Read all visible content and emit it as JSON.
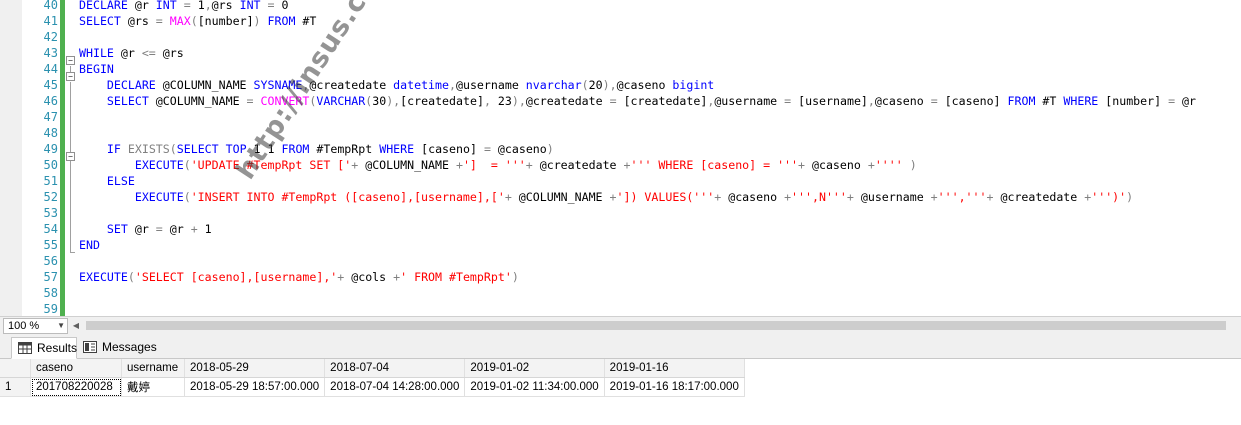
{
  "editor": {
    "line_numbers": [
      "40",
      "41",
      "42",
      "43",
      "44",
      "45",
      "46",
      "47",
      "48",
      "49",
      "50",
      "51",
      "52",
      "53",
      "54",
      "55",
      "56",
      "57",
      "58",
      "59"
    ],
    "lines": [
      [
        {
          "t": "kw",
          "v": "DECLARE"
        },
        {
          "t": "plain",
          "v": " @r "
        },
        {
          "t": "kw",
          "v": "INT"
        },
        {
          "t": "plain",
          "v": " "
        },
        {
          "t": "op",
          "v": "="
        },
        {
          "t": "plain",
          "v": " 1"
        },
        {
          "t": "op",
          "v": ","
        },
        {
          "t": "plain",
          "v": "@rs "
        },
        {
          "t": "kw",
          "v": "INT"
        },
        {
          "t": "plain",
          "v": " "
        },
        {
          "t": "op",
          "v": "="
        },
        {
          "t": "plain",
          "v": " 0"
        }
      ],
      [
        {
          "t": "kw",
          "v": "SELECT"
        },
        {
          "t": "plain",
          "v": " @rs "
        },
        {
          "t": "op",
          "v": "="
        },
        {
          "t": "plain",
          "v": " "
        },
        {
          "t": "fn",
          "v": "MAX"
        },
        {
          "t": "op",
          "v": "("
        },
        {
          "t": "plain",
          "v": "[number]"
        },
        {
          "t": "op",
          "v": ")"
        },
        {
          "t": "plain",
          "v": " "
        },
        {
          "t": "kw",
          "v": "FROM"
        },
        {
          "t": "plain",
          "v": " #T"
        }
      ],
      [],
      [
        {
          "t": "kw",
          "v": "WHILE"
        },
        {
          "t": "plain",
          "v": " @r "
        },
        {
          "t": "op",
          "v": "<="
        },
        {
          "t": "plain",
          "v": " @rs"
        }
      ],
      [
        {
          "t": "kw",
          "v": "BEGIN"
        }
      ],
      [
        {
          "t": "plain",
          "v": "    "
        },
        {
          "t": "kw",
          "v": "DECLARE"
        },
        {
          "t": "plain",
          "v": " @COLUMN_NAME "
        },
        {
          "t": "kw",
          "v": "SYSNAME"
        },
        {
          "t": "op",
          "v": ","
        },
        {
          "t": "plain",
          "v": "@createdate "
        },
        {
          "t": "kw",
          "v": "datetime"
        },
        {
          "t": "op",
          "v": ","
        },
        {
          "t": "plain",
          "v": "@username "
        },
        {
          "t": "kw",
          "v": "nvarchar"
        },
        {
          "t": "op",
          "v": "("
        },
        {
          "t": "plain",
          "v": "20"
        },
        {
          "t": "op",
          "v": "),"
        },
        {
          "t": "plain",
          "v": "@caseno "
        },
        {
          "t": "kw",
          "v": "bigint"
        }
      ],
      [
        {
          "t": "plain",
          "v": "    "
        },
        {
          "t": "kw",
          "v": "SELECT"
        },
        {
          "t": "plain",
          "v": " @COLUMN_NAME "
        },
        {
          "t": "op",
          "v": "="
        },
        {
          "t": "plain",
          "v": " "
        },
        {
          "t": "fn",
          "v": "CONVERT"
        },
        {
          "t": "op",
          "v": "("
        },
        {
          "t": "kw",
          "v": "VARCHAR"
        },
        {
          "t": "op",
          "v": "("
        },
        {
          "t": "plain",
          "v": "30"
        },
        {
          "t": "op",
          "v": "),"
        },
        {
          "t": "plain",
          "v": "[createdate]"
        },
        {
          "t": "op",
          "v": ","
        },
        {
          "t": "plain",
          "v": " 23"
        },
        {
          "t": "op",
          "v": "),"
        },
        {
          "t": "plain",
          "v": "@createdate "
        },
        {
          "t": "op",
          "v": "="
        },
        {
          "t": "plain",
          "v": " [createdate]"
        },
        {
          "t": "op",
          "v": ","
        },
        {
          "t": "plain",
          "v": "@username "
        },
        {
          "t": "op",
          "v": "="
        },
        {
          "t": "plain",
          "v": " [username]"
        },
        {
          "t": "op",
          "v": ","
        },
        {
          "t": "plain",
          "v": "@caseno "
        },
        {
          "t": "op",
          "v": "="
        },
        {
          "t": "plain",
          "v": " [caseno] "
        },
        {
          "t": "kw",
          "v": "FROM"
        },
        {
          "t": "plain",
          "v": " #T "
        },
        {
          "t": "kw",
          "v": "WHERE"
        },
        {
          "t": "plain",
          "v": " [number] "
        },
        {
          "t": "op",
          "v": "="
        },
        {
          "t": "plain",
          "v": " @r"
        }
      ],
      [],
      [],
      [
        {
          "t": "plain",
          "v": "    "
        },
        {
          "t": "kw",
          "v": "IF"
        },
        {
          "t": "plain",
          "v": " "
        },
        {
          "t": "op",
          "v": "EXISTS("
        },
        {
          "t": "kw",
          "v": "SELECT"
        },
        {
          "t": "plain",
          "v": " "
        },
        {
          "t": "kw",
          "v": "TOP"
        },
        {
          "t": "plain",
          "v": " 1 1 "
        },
        {
          "t": "kw",
          "v": "FROM"
        },
        {
          "t": "plain",
          "v": " #TempRpt "
        },
        {
          "t": "kw",
          "v": "WHERE"
        },
        {
          "t": "plain",
          "v": " [caseno] "
        },
        {
          "t": "op",
          "v": "="
        },
        {
          "t": "plain",
          "v": " @caseno"
        },
        {
          "t": "op",
          "v": ")"
        }
      ],
      [
        {
          "t": "plain",
          "v": "        "
        },
        {
          "t": "kw",
          "v": "EXECUTE"
        },
        {
          "t": "op",
          "v": "("
        },
        {
          "t": "st",
          "v": "'UPDATE #TempRpt SET ['"
        },
        {
          "t": "op",
          "v": "+"
        },
        {
          "t": "plain",
          "v": " @COLUMN_NAME "
        },
        {
          "t": "op",
          "v": "+"
        },
        {
          "t": "st",
          "v": "']  = '''"
        },
        {
          "t": "op",
          "v": "+"
        },
        {
          "t": "plain",
          "v": " @createdate "
        },
        {
          "t": "op",
          "v": "+"
        },
        {
          "t": "st",
          "v": "''' WHERE [caseno] = '''"
        },
        {
          "t": "op",
          "v": "+"
        },
        {
          "t": "plain",
          "v": " @caseno "
        },
        {
          "t": "op",
          "v": "+"
        },
        {
          "t": "st",
          "v": "''''"
        },
        {
          "t": "plain",
          "v": " "
        },
        {
          "t": "op",
          "v": ")"
        }
      ],
      [
        {
          "t": "plain",
          "v": "    "
        },
        {
          "t": "kw",
          "v": "ELSE"
        }
      ],
      [
        {
          "t": "plain",
          "v": "        "
        },
        {
          "t": "kw",
          "v": "EXECUTE"
        },
        {
          "t": "op",
          "v": "("
        },
        {
          "t": "st",
          "v": "'INSERT INTO #TempRpt ([caseno],[username],['"
        },
        {
          "t": "op",
          "v": "+"
        },
        {
          "t": "plain",
          "v": " @COLUMN_NAME "
        },
        {
          "t": "op",
          "v": "+"
        },
        {
          "t": "st",
          "v": "']) VALUES('''"
        },
        {
          "t": "op",
          "v": "+"
        },
        {
          "t": "plain",
          "v": " @caseno "
        },
        {
          "t": "op",
          "v": "+"
        },
        {
          "t": "st",
          "v": "''',N'''"
        },
        {
          "t": "op",
          "v": "+"
        },
        {
          "t": "plain",
          "v": " @username "
        },
        {
          "t": "op",
          "v": "+"
        },
        {
          "t": "st",
          "v": "''','''"
        },
        {
          "t": "op",
          "v": "+"
        },
        {
          "t": "plain",
          "v": " @createdate "
        },
        {
          "t": "op",
          "v": "+"
        },
        {
          "t": "st",
          "v": "''')'"
        },
        {
          "t": "op",
          "v": ")"
        }
      ],
      [],
      [
        {
          "t": "plain",
          "v": "    "
        },
        {
          "t": "kw",
          "v": "SET"
        },
        {
          "t": "plain",
          "v": " @r "
        },
        {
          "t": "op",
          "v": "="
        },
        {
          "t": "plain",
          "v": " @r "
        },
        {
          "t": "op",
          "v": "+"
        },
        {
          "t": "plain",
          "v": " 1"
        }
      ],
      [
        {
          "t": "kw",
          "v": "END"
        }
      ],
      [],
      [
        {
          "t": "kw",
          "v": "EXECUTE"
        },
        {
          "t": "op",
          "v": "("
        },
        {
          "t": "st",
          "v": "'SELECT [caseno],[username],'"
        },
        {
          "t": "op",
          "v": "+"
        },
        {
          "t": "plain",
          "v": " @cols "
        },
        {
          "t": "op",
          "v": "+"
        },
        {
          "t": "st",
          "v": "' FROM #TempRpt'"
        },
        {
          "t": "op",
          "v": ")"
        }
      ],
      [],
      []
    ],
    "watermark": "http://insus.cnblogs.com"
  },
  "zoom": {
    "value": "100 %"
  },
  "results_tabs": [
    {
      "label": "Results",
      "icon": "grid-icon",
      "active": true
    },
    {
      "label": "Messages",
      "icon": "messages-icon",
      "active": false
    }
  ],
  "results_grid": {
    "columns": [
      "caseno",
      "username",
      "2018-05-29",
      "2018-07-04",
      "2019-01-02",
      "2019-01-16"
    ],
    "rows": [
      {
        "row_number": "1",
        "cells": [
          "201708220028",
          "戴婷",
          "2018-05-29 18:57:00.000",
          "2018-07-04 14:28:00.000",
          "2019-01-02 11:34:00.000",
          "2019-01-16 18:17:00.000"
        ]
      }
    ]
  },
  "colors": {
    "keyword": "#0000ff",
    "function": "#ff00ff",
    "string": "#ff0000",
    "operator": "#808080",
    "line_number": "#2b91af",
    "change_bar": "#4fb04f"
  }
}
